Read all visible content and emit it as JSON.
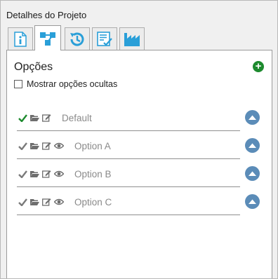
{
  "panel": {
    "title": "Detalhes do Projeto"
  },
  "tabs": [
    {
      "icon": "info-icon",
      "active": false
    },
    {
      "icon": "structure-icon",
      "active": true
    },
    {
      "icon": "history-icon",
      "active": false
    },
    {
      "icon": "checklist-icon",
      "active": false
    },
    {
      "icon": "factory-icon",
      "active": false
    }
  ],
  "options_section": {
    "title": "Opções",
    "show_hidden_label": "Mostrar opções ocultas",
    "show_hidden_checked": false
  },
  "options": [
    {
      "label": "Default",
      "active": true,
      "visibility_icon": false
    },
    {
      "label": "Option A",
      "active": false,
      "visibility_icon": true
    },
    {
      "label": "Option B",
      "active": false,
      "visibility_icon": true
    },
    {
      "label": "Option C",
      "active": false,
      "visibility_icon": true
    }
  ],
  "colors": {
    "active_check": "#1d8a2e",
    "inactive_icon": "#7a7a7a",
    "tab_icon": "#2a9fd8",
    "up_button": "#5b8cb8",
    "add_button": "#1d8a2e"
  }
}
